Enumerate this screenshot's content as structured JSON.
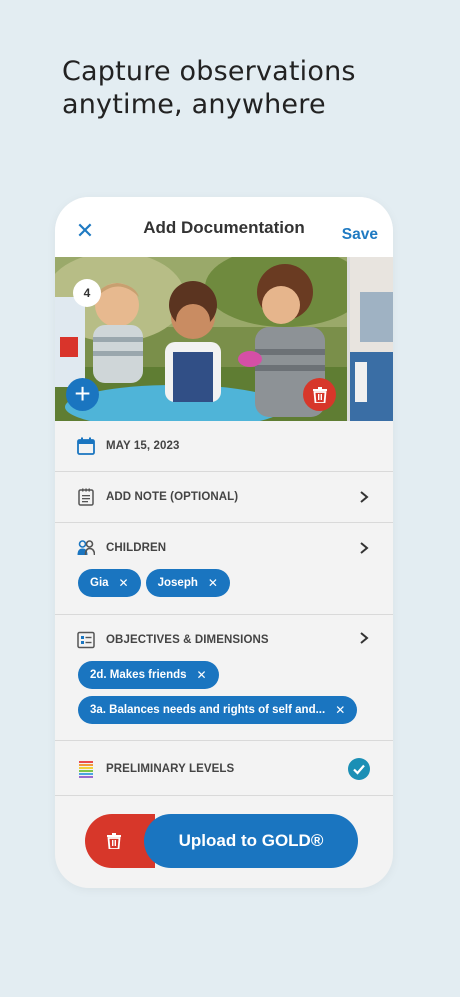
{
  "headline": {
    "line1": "Capture observations",
    "line2": "anytime, anywhere"
  },
  "header": {
    "close_glyph": "✕",
    "title": "Add Documentation",
    "save_label": "Save"
  },
  "photos": {
    "count": "4",
    "add_glyph": "+"
  },
  "date": {
    "icon": "calendar-icon",
    "value": "MAY 15, 2023"
  },
  "note": {
    "icon": "notepad-icon",
    "label": "ADD NOTE (OPTIONAL)"
  },
  "children": {
    "icon": "people-icon",
    "label": "CHILDREN",
    "chips": [
      {
        "label": "Gia",
        "remove": "✕"
      },
      {
        "label": "Joseph",
        "remove": "✕"
      }
    ]
  },
  "objectives": {
    "icon": "list-icon",
    "label": "OBJECTIVES & DIMENSIONS",
    "chips": [
      {
        "label": "2d. Makes friends",
        "remove": "✕"
      },
      {
        "label": "3a. Balances needs and rights of self and...",
        "remove": "✕"
      }
    ]
  },
  "levels": {
    "icon": "rainbow-levels-icon",
    "label": "PRELIMINARY LEVELS"
  },
  "footer": {
    "upload_label": "Upload to GOLD®"
  },
  "colors": {
    "accent_blue": "#1a75c0",
    "delete_red": "#d7372a",
    "check_teal": "#1b8fb5",
    "background": "#e3edf2"
  }
}
